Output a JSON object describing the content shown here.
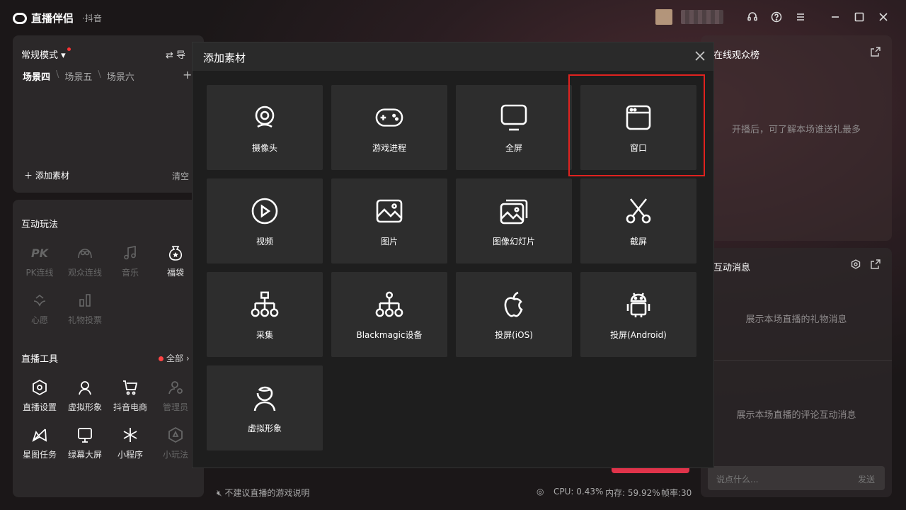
{
  "app": {
    "name": "直播伴侣",
    "platform": "·抖音"
  },
  "scene": {
    "mode": "常规模式",
    "guide": "导",
    "tabs": [
      "场景四",
      "场景五",
      "场景六"
    ],
    "add_material": "添加素材",
    "clear": "清空"
  },
  "interactive": {
    "title": "互动玩法",
    "items": [
      {
        "label": "PK连线",
        "icon": "pk-icon",
        "enabled": false
      },
      {
        "label": "观众连线",
        "icon": "audience-link-icon",
        "enabled": false
      },
      {
        "label": "音乐",
        "icon": "music-icon",
        "enabled": false
      },
      {
        "label": "福袋",
        "icon": "lucky-bag-icon",
        "enabled": true
      },
      {
        "label": "心愿",
        "icon": "wish-icon",
        "enabled": false
      },
      {
        "label": "礼物投票",
        "icon": "gift-vote-icon",
        "enabled": false
      }
    ]
  },
  "live_tools": {
    "title": "直播工具",
    "all": "全部",
    "items": [
      {
        "label": "直播设置",
        "icon": "live-settings-icon",
        "enabled": true
      },
      {
        "label": "虚拟形象",
        "icon": "avatar-icon",
        "enabled": true
      },
      {
        "label": "抖音电商",
        "icon": "cart-icon",
        "enabled": true
      },
      {
        "label": "管理员",
        "icon": "admin-icon",
        "enabled": false
      },
      {
        "label": "星图任务",
        "icon": "star-map-icon",
        "enabled": true
      },
      {
        "label": "绿幕大屏",
        "icon": "green-screen-icon",
        "enabled": true
      },
      {
        "label": "小程序",
        "icon": "mini-program-icon",
        "enabled": true
      },
      {
        "label": "小玩法",
        "icon": "mini-game-icon",
        "enabled": false
      }
    ]
  },
  "right": {
    "ranking_title": "在线观众榜",
    "ranking_empty": "开播后，可了解本场谁送礼最多",
    "messages_title": "互动消息",
    "gift_empty": "展示本场直播的礼物消息",
    "comment_empty": "展示本场直播的评论互动消息",
    "chat_placeholder": "说点什么...",
    "send": "发送"
  },
  "status": {
    "tip": "不建议直播的游戏说明",
    "cpu": "CPU: 0.43%",
    "mem": "内存: 59.92%",
    "fps": "帧率:30"
  },
  "modal": {
    "title": "添加素材",
    "tiles": [
      {
        "label": "摄像头",
        "icon": "camera-icon"
      },
      {
        "label": "游戏进程",
        "icon": "gamepad-icon"
      },
      {
        "label": "全屏",
        "icon": "monitor-icon"
      },
      {
        "label": "窗口",
        "icon": "window-icon",
        "highlighted": true
      },
      {
        "label": "视频",
        "icon": "play-icon"
      },
      {
        "label": "图片",
        "icon": "image-icon"
      },
      {
        "label": "图像幻灯片",
        "icon": "slideshow-icon"
      },
      {
        "label": "截屏",
        "icon": "scissors-icon"
      },
      {
        "label": "采集",
        "icon": "capture-icon"
      },
      {
        "label": "Blackmagic设备",
        "icon": "blackmagic-icon"
      },
      {
        "label": "投屏(iOS)",
        "icon": "apple-icon"
      },
      {
        "label": "投屏(Android)",
        "icon": "android-icon"
      },
      {
        "label": "虚拟形象",
        "icon": "avatar-icon"
      }
    ]
  },
  "colors": {
    "highlight": "#e0221f",
    "accent": "#e0334a"
  }
}
